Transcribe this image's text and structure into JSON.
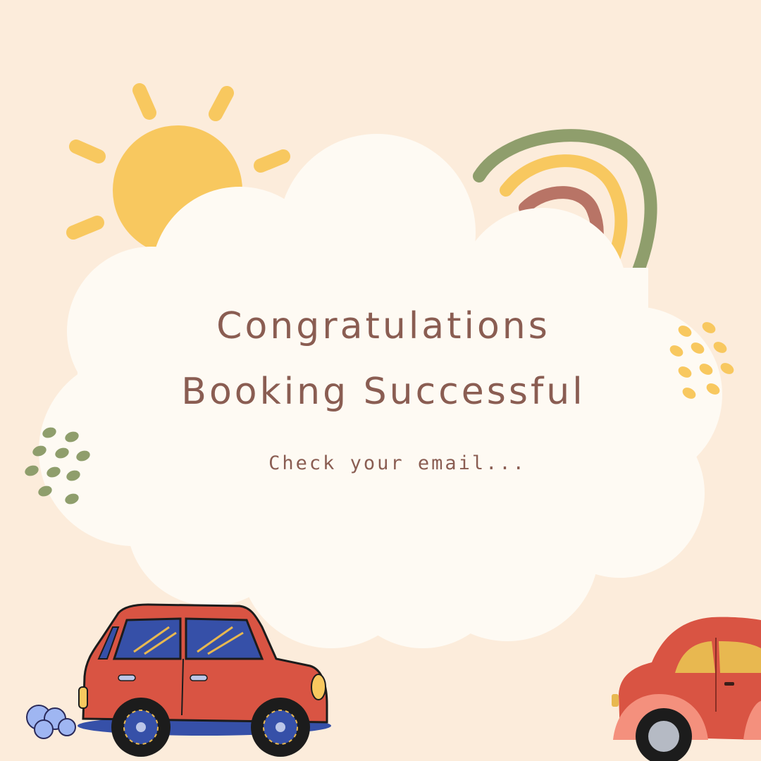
{
  "message": {
    "title_line1": "Congratulations",
    "title_line2": "Booking Successful",
    "subtitle": "Check your email..."
  },
  "colors": {
    "background": "#fcecdb",
    "cloud": "#fefaf3",
    "text": "#8a5d52",
    "sun": "#f8c85f",
    "rainbow_outer": "#8f9e6c",
    "rainbow_middle": "#f8c85f",
    "rainbow_inner": "#b87466",
    "car_red": "#d95443",
    "car_window_blue": "#3650a8",
    "car_window_yellow": "#e8b850",
    "tire": "#1c1c1c",
    "puff_blue": "#9fb6f2"
  },
  "decorations": {
    "sun": "sun-icon",
    "rainbow": "rainbow-icon",
    "cloud": "cloud-shape",
    "dots_green": "dot-cluster-green",
    "dots_yellow": "dot-cluster-yellow",
    "car_left": "car-icon",
    "car_right": "beetle-car-icon",
    "exhaust": "exhaust-puff-icon"
  }
}
